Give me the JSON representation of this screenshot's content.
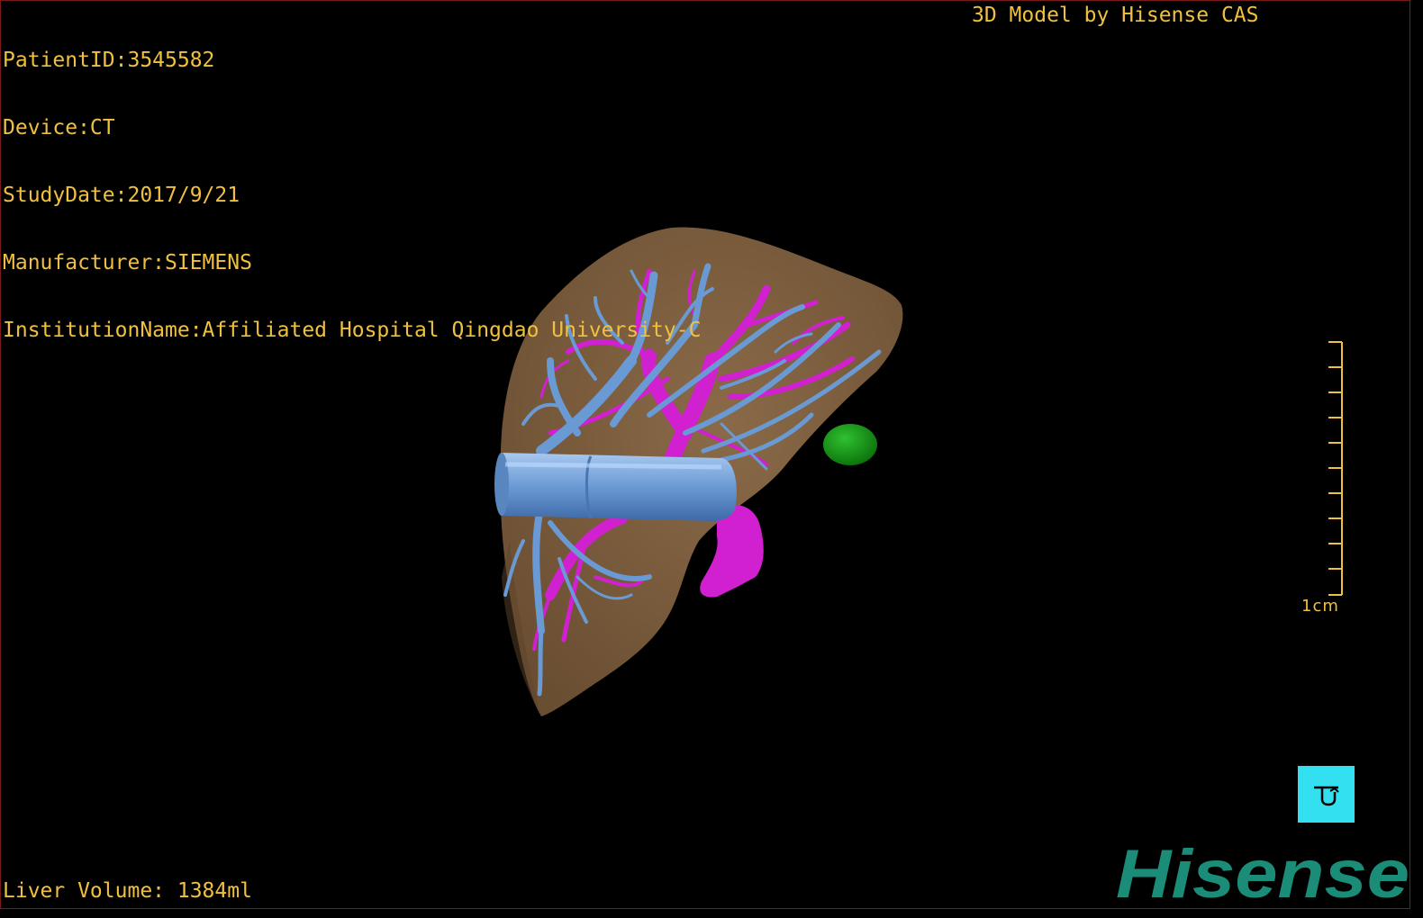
{
  "overlay": {
    "patient_line": "PatientID:3545582",
    "device_line": "Device:CT",
    "study_date_line": "StudyDate:2017/9/21",
    "manufacturer_line": "Manufacturer:SIEMENS",
    "institution_line": "InstitutionName:Affiliated Hospital Qingdao University-C",
    "credit": "3D Model by Hisense CAS",
    "liver_volume": "Liver Volume: 1384ml"
  },
  "scale_bar": {
    "label": "1cm"
  },
  "logo": {
    "text": "Hisense"
  },
  "reset_button": {
    "icon": "reset-view-icon"
  },
  "colors": {
    "overlay_text": "#f0c040",
    "liver": "#7a5c3c",
    "hepatic_vein": "#6a9ad4",
    "portal_vein": "#d020d0",
    "tumor": "#18a018",
    "logo": "#1a8c78",
    "reset_button": "#33e0f0"
  }
}
